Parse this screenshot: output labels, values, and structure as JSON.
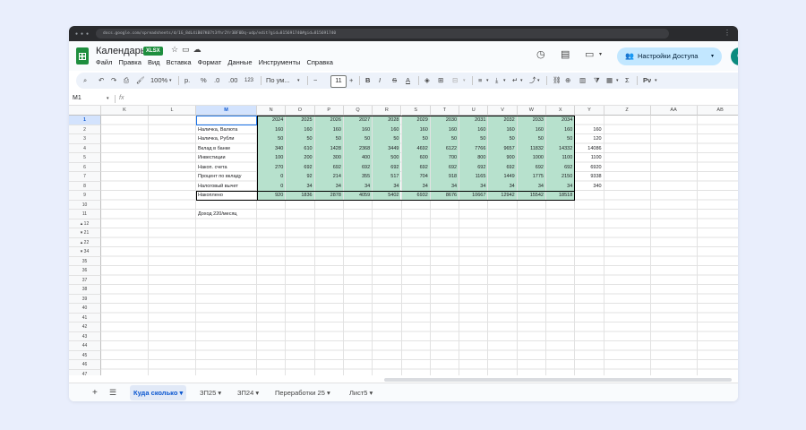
{
  "browser": {
    "url": "docs.google.com/spreadsheets/d/1G_8dL4iB07K07t3fhr2Yr3BF0Dq-udp/edit?gid=815691740#gid=815691740"
  },
  "document": {
    "title": "Календарь",
    "badge": "XLSX"
  },
  "menu": [
    "Файл",
    "Правка",
    "Вид",
    "Вставка",
    "Формат",
    "Данные",
    "Инструменты",
    "Справка"
  ],
  "share": {
    "label": "Настройки Доступа"
  },
  "avatar": {
    "letter": "С"
  },
  "toolbar": {
    "zoom": "100%",
    "currency_label": "р.",
    "percent_label": "%",
    "decimals_label": ".0",
    "decimals_more_label": ".00",
    "number_format_label": "123",
    "font": "По ум...",
    "font_size": "11",
    "bold": "B",
    "italic": "I",
    "strike": "S",
    "text_color": "A",
    "sigma": "Σ",
    "input_tools": "Рν"
  },
  "formula_bar": {
    "name_box": "M1",
    "fx": "fx"
  },
  "columns_left": [
    "K",
    "L",
    "M"
  ],
  "columns_data": [
    "N",
    "O",
    "P",
    "Q",
    "R",
    "S",
    "T",
    "U",
    "V",
    "W",
    "X",
    "Y",
    "Z",
    "AA",
    "AB"
  ],
  "row_labels": [
    "1",
    "2",
    "3",
    "4",
    "5",
    "6",
    "7",
    "8",
    "9",
    "10",
    "11",
    "12",
    "21",
    "22",
    "34",
    "35",
    "36",
    "37",
    "38",
    "39",
    "40",
    "41",
    "42",
    "43",
    "44",
    "45",
    "46",
    "47"
  ],
  "years": [
    "2024",
    "2025",
    "2026",
    "2027",
    "2028",
    "2029",
    "2030",
    "2031",
    "2032",
    "2033",
    "2034"
  ],
  "table_rows": [
    {
      "label": "Наличка, Валюта",
      "values": [
        "160",
        "160",
        "160",
        "160",
        "160",
        "160",
        "160",
        "160",
        "160",
        "160",
        "160"
      ],
      "y": "160"
    },
    {
      "label": "Наличка, Рубли",
      "values": [
        "50",
        "50",
        "50",
        "50",
        "50",
        "50",
        "50",
        "50",
        "50",
        "50",
        "50"
      ],
      "y": "120"
    },
    {
      "label": "Вклад в банке",
      "values": [
        "340",
        "610",
        "1428",
        "2368",
        "3449",
        "4692",
        "6122",
        "7766",
        "9657",
        "11832",
        "14332"
      ],
      "y": "14086"
    },
    {
      "label": "Инвестиции",
      "values": [
        "100",
        "200",
        "300",
        "400",
        "500",
        "600",
        "700",
        "800",
        "900",
        "1000",
        "1100"
      ],
      "y": "1100"
    },
    {
      "label": "Накоп. счета",
      "values": [
        "270",
        "692",
        "692",
        "692",
        "692",
        "692",
        "692",
        "692",
        "692",
        "692",
        "692"
      ],
      "y": "6920"
    },
    {
      "label": "Процент по вкладу",
      "values": [
        "0",
        "92",
        "214",
        "355",
        "517",
        "704",
        "918",
        "1165",
        "1449",
        "1775",
        "2150"
      ],
      "y": "9338"
    },
    {
      "label": "Налоговый вычет",
      "values": [
        "0",
        "34",
        "34",
        "34",
        "34",
        "34",
        "34",
        "34",
        "34",
        "34",
        "34"
      ],
      "y": "340"
    },
    {
      "label": "Накоплено",
      "values": [
        "920",
        "1836",
        "2878",
        "4059",
        "5402",
        "6932",
        "8676",
        "10667",
        "12942",
        "15542",
        "18518"
      ],
      "y": ""
    }
  ],
  "note": "Доход 220/месяц",
  "sheet_tabs": [
    "Куда сколько",
    "ЗП25",
    "ЗП24",
    "Переработки 25",
    "Лист5"
  ],
  "colors": {
    "accent": "#0b57d0",
    "cell_green": "#b7e1cd",
    "sheets_green": "#1e8e3e"
  }
}
